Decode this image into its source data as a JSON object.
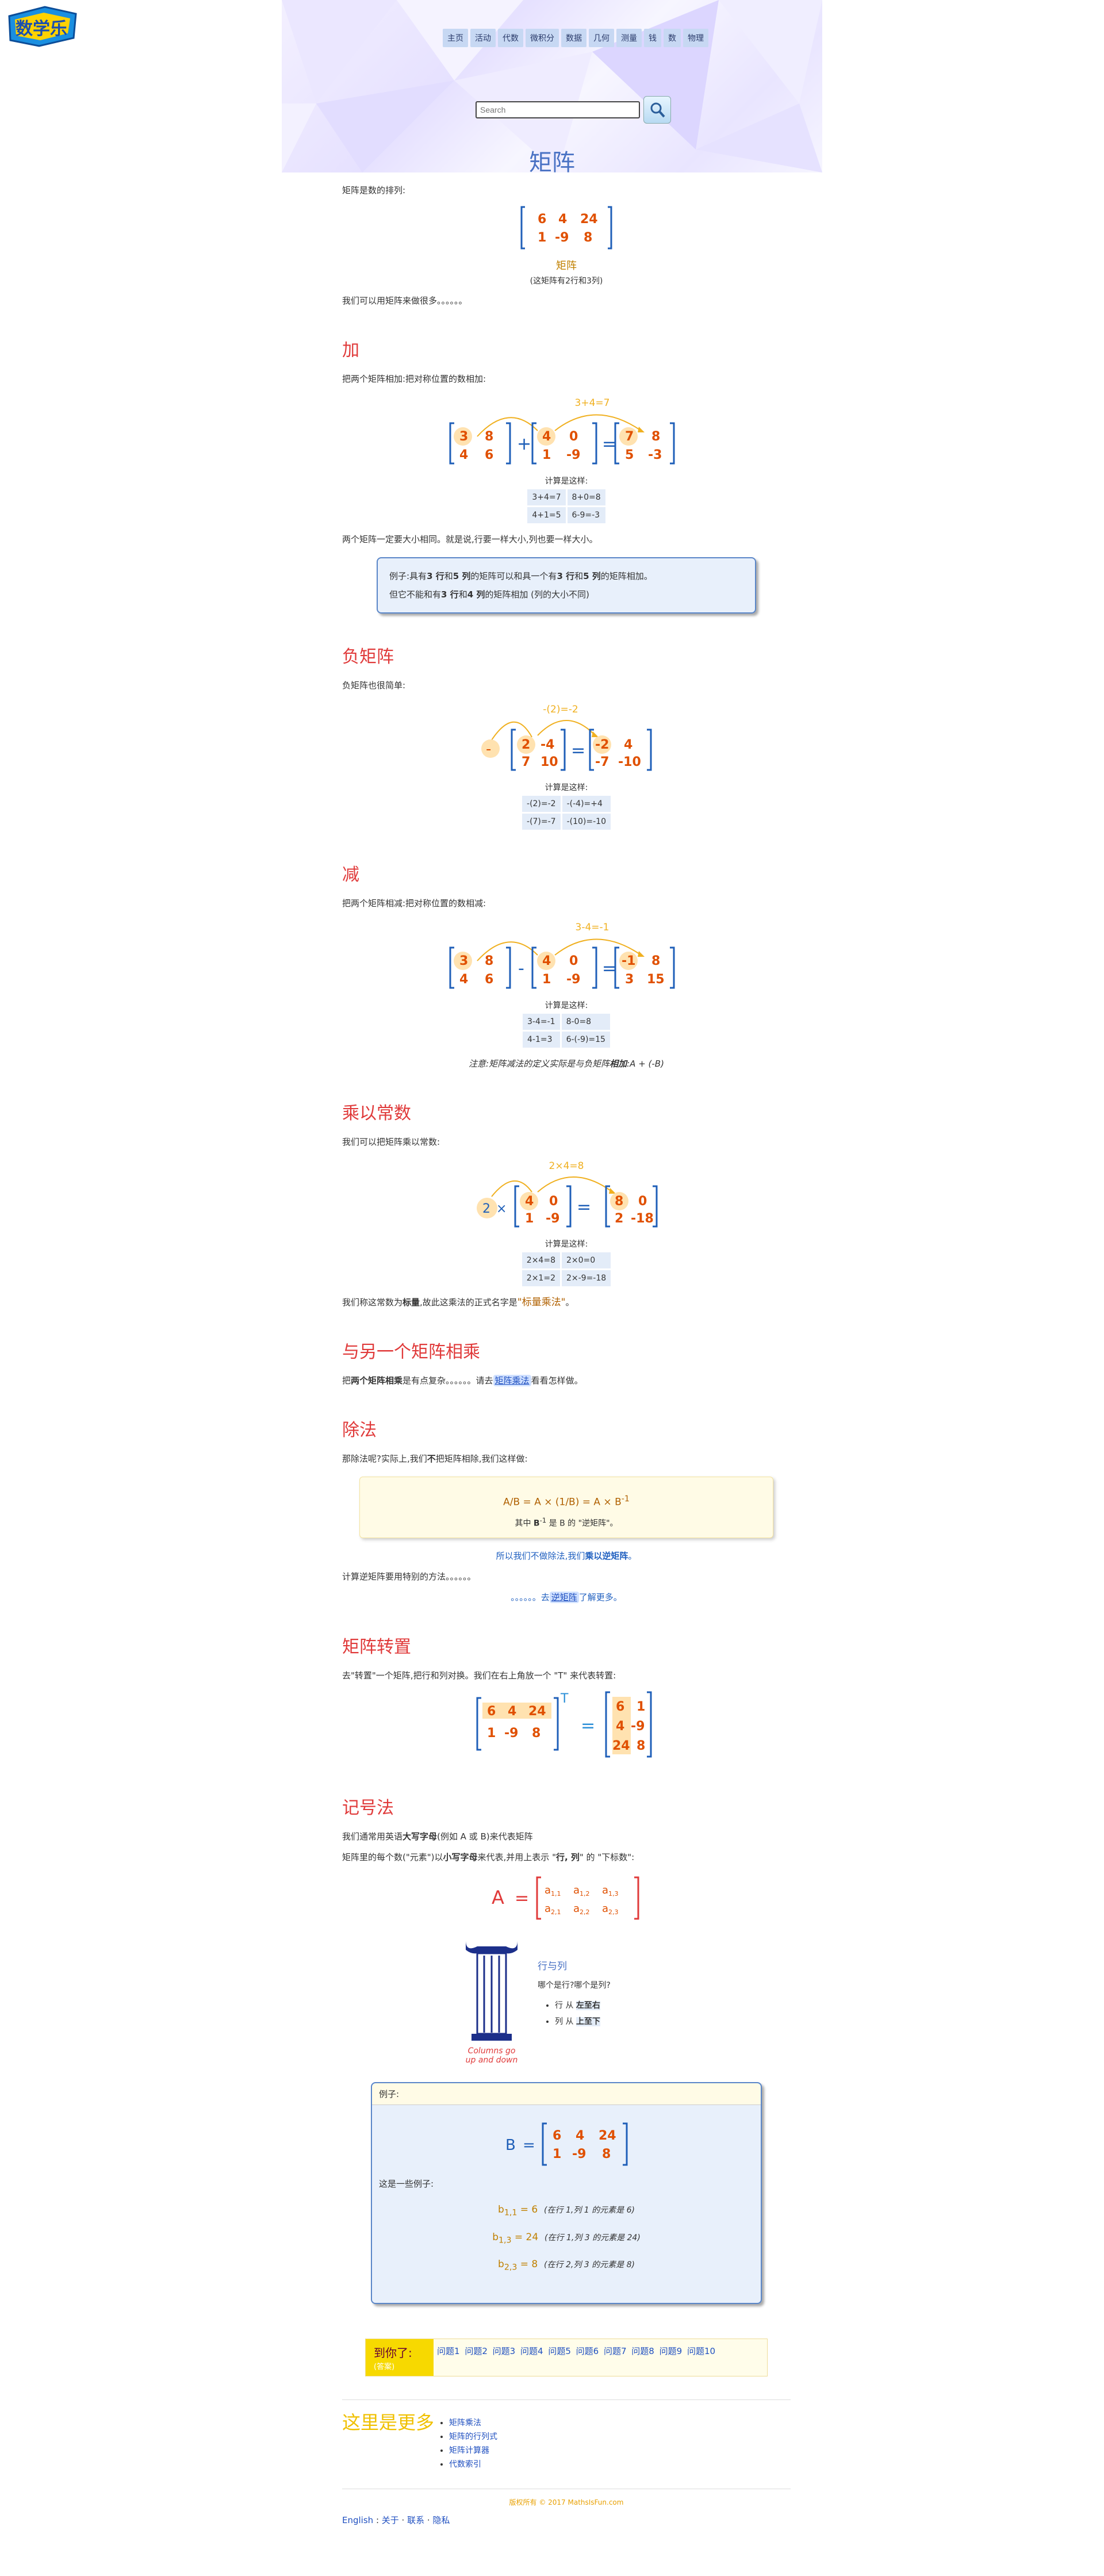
{
  "logo_text": "数学乐",
  "nav": [
    "主页",
    "活动",
    "代数",
    "微积分",
    "数据",
    "几何",
    "测量",
    "钱",
    "数",
    "物理"
  ],
  "search_placeholder": "Search",
  "title": "矩阵",
  "intro": "矩阵是数的排列:",
  "intro_caption": "矩阵",
  "intro_note": "(这矩阵有2行和3列)",
  "intro_more": "我们可以用矩阵来做很多。。。。。。",
  "add": {
    "h": "加",
    "p": "把两个矩阵相加:把对称位置的数相加:",
    "arrow": "3+4=7",
    "calc_cap": "计算是这样:",
    "calc": [
      "3+4=7",
      "8+0=8",
      "4+1=5",
      "6-9=-3"
    ],
    "p2": "两个矩阵一定要大小相同。就是说,行要一样大小,列也要一样大小。",
    "note1_pre": "例子:具有",
    "note1_b1": "3 行",
    "note1_mid": "和",
    "note1_b2": "5 列",
    "note1_post": "的矩阵可以和具一个有",
    "note1_b3": "3 行",
    "note1_mid2": "和",
    "note1_b4": "5 列",
    "note1_end": "的矩阵相加。",
    "note2_pre": "但它不能和有",
    "note2_b1": "3 行",
    "note2_mid": "和",
    "note2_b2": "4 列",
    "note2_end": "的矩阵相加 (列的大小不同)"
  },
  "neg": {
    "h": "负矩阵",
    "p": "负矩阵也很简单:",
    "arrow": "-(2)=-2",
    "calc_cap": "计算是这样:",
    "calc": [
      "-(2)=-2",
      "-(-4)=+4",
      "-(7)=-7",
      "-(10)=-10"
    ]
  },
  "sub": {
    "h": "减",
    "p": "把两个矩阵相减:把对称位置的数相减:",
    "arrow": "3-4=-1",
    "calc_cap": "计算是这样:",
    "calc": [
      "3-4=-1",
      "8-0=8",
      "4-1=3",
      "6-(-9)=15"
    ],
    "note_pre": "注意:矩阵减法的定义实际是与负矩阵",
    "note_b": "相加",
    "note_post": ":A + (-B)"
  },
  "scal": {
    "h": "乘以常数",
    "p": "我们可以把矩阵乘以常数:",
    "arrow": "2×4=8",
    "calc_cap": "计算是这样:",
    "calc": [
      "2×4=8",
      "2×0=0",
      "2×1=2",
      "2×-9=-18"
    ],
    "p2_pre": "我们称这常数为",
    "p2_b": "标量",
    "p2_mid": ",故此这乘法的正式名字是",
    "p2_link": "\"标量乘法\"",
    "p2_end": "。"
  },
  "mult": {
    "h": "与另一个矩阵相乘",
    "p_pre": "把",
    "p_b": "两个矩阵相乘",
    "p_mid": "是有点复杂。。。。。。请去",
    "p_link": "矩阵乘法",
    "p_end": "看看怎样做。"
  },
  "div": {
    "h": "除法",
    "p_pre": "那除法呢?实际上,我们",
    "p_b": "不",
    "p_post": "把矩阵相除,我们这样做:",
    "formula": "A/B = A × (1/B) = A × B",
    "formula_sup": "-1",
    "formula2_pre": "其中 ",
    "formula2_b": "B",
    "formula2_sup": "-1",
    "formula2_post": " 是 B 的 \"逆矩阵\"。",
    "p2_pre": "所以我们不做除法,我们",
    "p2_b": "乘以逆矩阵",
    "p2_end": "。",
    "p3": "计算逆矩阵要用特别的方法。。。。。。",
    "p4_pre": "。。。。。。去",
    "p4_link": "逆矩阵",
    "p4_post": "了解更多。"
  },
  "trans": {
    "h": "矩阵转置",
    "p": "去\"转置\"一个矩阵,把行和列对换。我们在右上角放一个 \"T\" 来代表转置:"
  },
  "notation": {
    "h": "记号法",
    "p1_pre": "我们通常用英语",
    "p1_b": "大写字母",
    "p1_post": "(例如 A 或 B)来代表矩阵",
    "p2_pre": "矩阵里的每个数(\"元素\")以",
    "p2_b": "小写字母",
    "p2_mid": "来代表,并用上表示 \"",
    "p2_b2": "行, 列",
    "p2_end": "\" 的 \"下标数\":",
    "col_cap1": "Columns go",
    "col_cap2": "up and down",
    "rc_title": "行与列",
    "rc_q": "哪个是行?哪个是列?",
    "rc_row_pre": "行 从 ",
    "rc_row_b": "左至右",
    "rc_col_pre": "列 从 ",
    "rc_col_b": "上至下"
  },
  "example": {
    "head": "例子:",
    "p": "这是一些例子:",
    "l1_a": "b",
    "l1_sub": "1,1",
    "l1_v": " = 6",
    "l1_n": "(在行 1,列 1 的元素是 6)",
    "l2_a": "b",
    "l2_sub": "1,3",
    "l2_v": " = 24",
    "l2_n": "(在行 1,列 3 的元素是 24)",
    "l3_a": "b",
    "l3_sub": "2,3",
    "l3_v": " = 8",
    "l3_n": "(在行 2,列 3 的元素是 8)"
  },
  "quiz": {
    "t1": "到你了:",
    "t2": "(答案)",
    "links": [
      "问题1",
      "问题2",
      "问题3",
      "问题4",
      "问题5",
      "问题6",
      "问题7",
      "问题8",
      "问题9",
      "问题10"
    ]
  },
  "more": {
    "h": "这里是更多",
    "links": [
      "矩阵乘法",
      "矩阵的行列式",
      "矩阵计算器",
      "代数索引"
    ]
  },
  "footer": "版权所有 © 2017 MathsIsFun.com",
  "bottom": [
    "English",
    "关于",
    "联系",
    "隐私"
  ]
}
